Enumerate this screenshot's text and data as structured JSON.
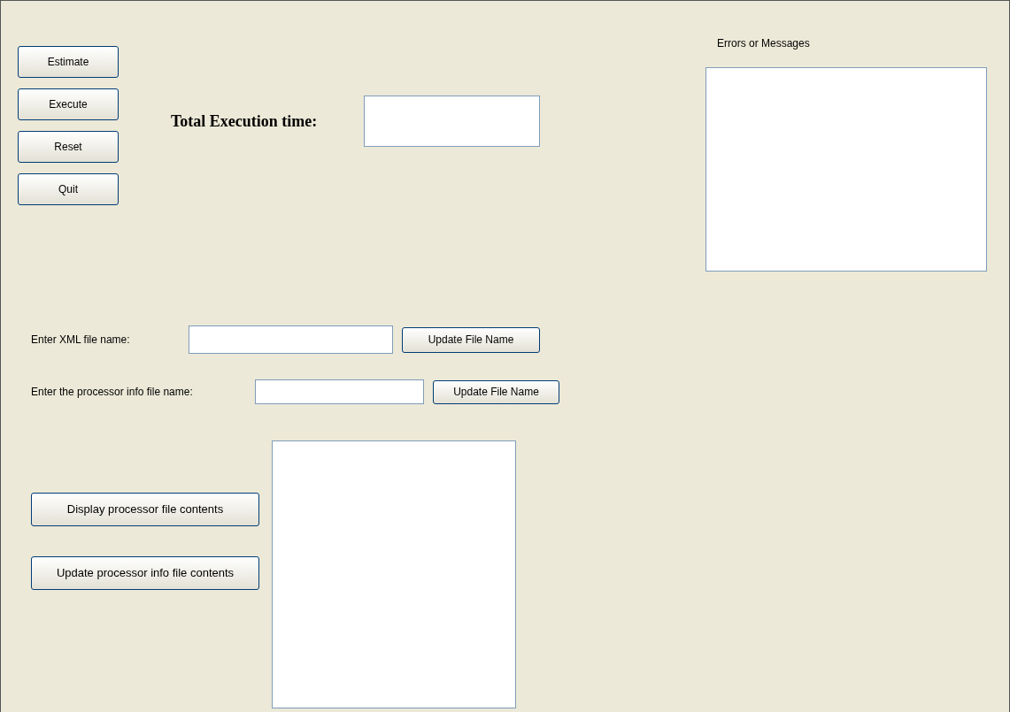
{
  "control_buttons": [
    {
      "label": "Estimate"
    },
    {
      "label": "Execute"
    },
    {
      "label": "Reset"
    },
    {
      "label": "Quit"
    }
  ],
  "execution_time": {
    "label": "Total Execution time:"
  },
  "messages": {
    "label": "Errors or Messages"
  },
  "file_rows": [
    {
      "label": "Enter XML file name:",
      "button": "Update File Name"
    },
    {
      "label": "Enter the processor info file name:",
      "button": "Update File Name"
    }
  ],
  "processor_buttons": [
    {
      "label": "Display processor file contents"
    },
    {
      "label": "Update processor info file contents"
    }
  ]
}
